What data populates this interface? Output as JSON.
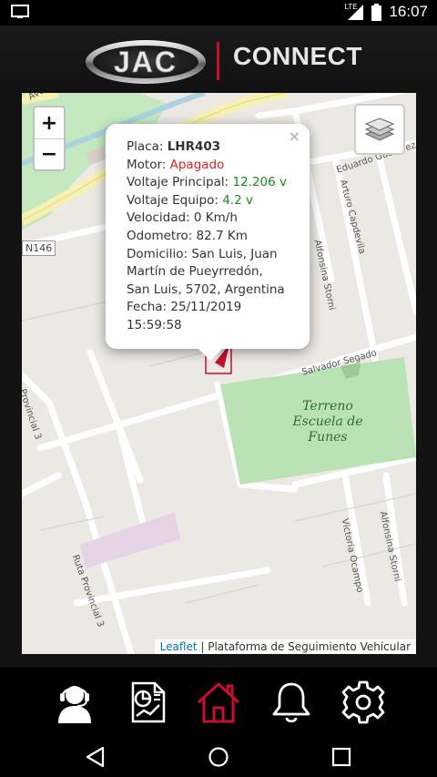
{
  "status_bar": {
    "time": "16:07",
    "network": "LTE"
  },
  "header": {
    "brand": "JAC",
    "title": "CONNECT"
  },
  "map": {
    "zoom_in": "+",
    "zoom_out": "−",
    "route_badge": "N146",
    "streets": {
      "avenida": "Avenida",
      "eduardo": "Eduardo Gutiérrez",
      "arturo": "Arturo Capdevila",
      "alfonsina_top": "Alfonsina Storni",
      "alfonsina_bottom": "Alfonsina Storni",
      "salvador": "Salvador Segado",
      "victoria": "Victoria Ocampo",
      "ruta": "Ruta Provincial 3",
      "ruta_left": "Provincial 3"
    },
    "park_label": "Terreno Escuela de Funes",
    "attribution_link": "Leaflet",
    "attribution_text": " | Plataforma de Seguimiento Vehicular"
  },
  "popup": {
    "close": "×",
    "placa_label": "Placa: ",
    "placa_value": "LHR403",
    "motor_label": "Motor: ",
    "motor_value": "Apagado",
    "vprincipal_label": "Voltaje Principal: ",
    "vprincipal_value": "12.206 v",
    "vequipo_label": "Voltaje Equipo: ",
    "vequipo_value": "4.2 v",
    "velocidad": "Velocidad: 0 Km/h",
    "odometro": "Odometro: 82.7 Km",
    "domicilio": "Domicilio: San Luis, Juan Martín de Pueyrredón, San Luis, 5702, Argentina",
    "fecha": "Fecha: 25/11/2019 15:59:58"
  },
  "colors": {
    "brand_red": "#c8102e",
    "motor_off": "#dd2222",
    "voltage_ok": "#1a8a1a",
    "park": "#b9e3b4"
  },
  "bottom_nav": [
    "support-agent-icon",
    "reports-icon",
    "home-icon",
    "bell-icon",
    "gear-icon"
  ],
  "active_nav": "home-icon"
}
